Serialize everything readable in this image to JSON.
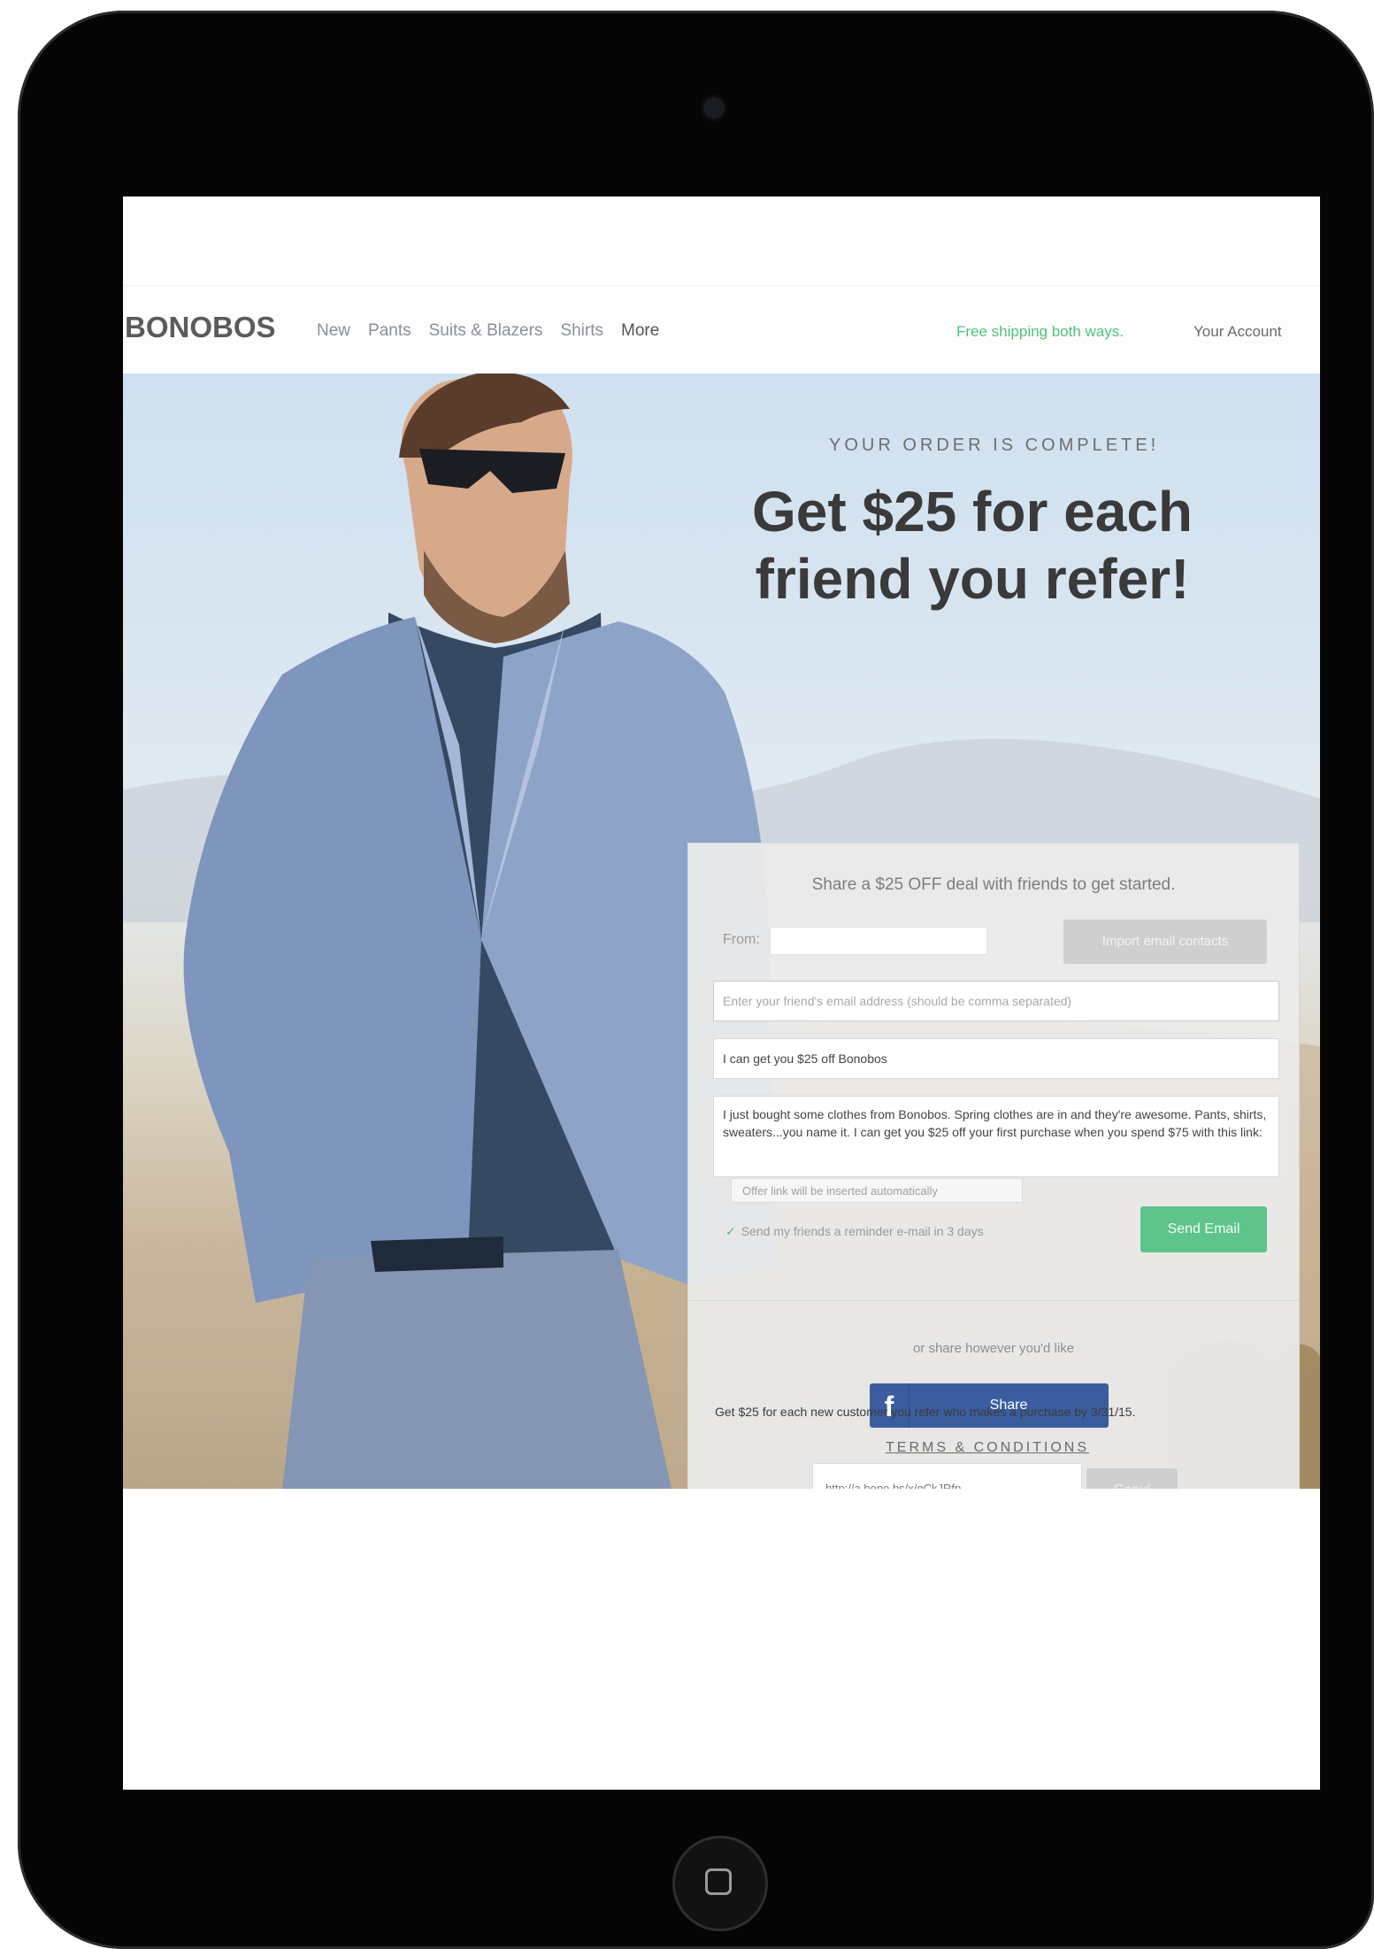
{
  "nav": {
    "brand": "BONOBOS",
    "links": [
      "New",
      "Pants",
      "Suits & Blazers",
      "Shirts",
      "More"
    ],
    "promo": "Free shipping both ways.",
    "account": "Your Account"
  },
  "hero": {
    "eyebrow": "YOUR ORDER IS COMPLETE!",
    "headline": "Get $25 for each friend you refer!"
  },
  "refer_panel": {
    "subtitle": "Share a $25 OFF deal with friends to get started.",
    "from_label": "From:",
    "from_value": "",
    "import_button": "Import email contacts",
    "emails_placeholder": "Enter your friend's email address (should be comma separated)",
    "subject_value": "I can get you $25 off Bonobos",
    "message_value": "I just bought some clothes from Bonobos. Spring clothes are in and they're awesome. Pants, shirts, sweaters...you name it. I can get you $25 off your first purchase when you spend $75 with this link:",
    "offer_note": "Offer link will be inserted automatically",
    "reminder_label": "Send my friends a reminder e-mail in 3 days",
    "reminder_checked": true,
    "send_button": "Send Email",
    "share_however": "or share however you'd like",
    "facebook_button": "Share",
    "share_link": "http://a.bono.bs/x/qCkJRfp",
    "copy_button": "Copy!"
  },
  "footer": {
    "note": "Get $25 for each new customer you refer who makes a purchase by 3/31/15.",
    "terms": "TERMS & CONDITIONS"
  },
  "colors": {
    "accent_green": "#5fc48b",
    "facebook_blue": "#3b5da0",
    "promo_green": "#4fc27a"
  }
}
